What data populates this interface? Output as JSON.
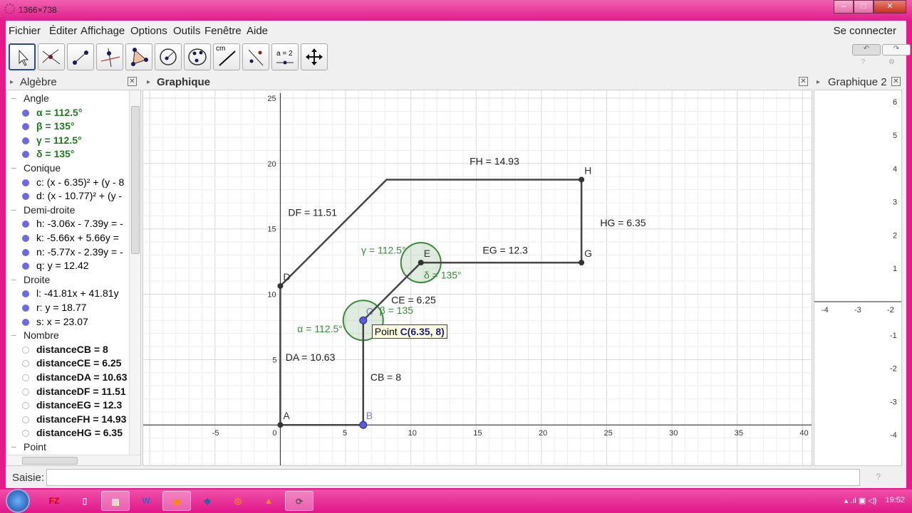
{
  "window": {
    "title": "1366×738",
    "min": "–",
    "max": "□",
    "close": "✕"
  },
  "menu": {
    "items": [
      "Fichier",
      "Éditer",
      "Affichage",
      "Options",
      "Outils",
      "Fenêtre",
      "Aide"
    ],
    "login": "Se connecter"
  },
  "toolbar": {
    "tools": [
      "move",
      "point-intersect",
      "segment",
      "perpendicular",
      "polygon",
      "circle",
      "conic-5pts",
      "distance",
      "reflect",
      "slider",
      "move-graphics"
    ],
    "measure_label": "cm",
    "slider_label": "a = 2",
    "undo": "↶",
    "redo": "↷",
    "help": "?",
    "settings": "⚙"
  },
  "panels": {
    "algebra": "Algèbre",
    "graphics": "Graphique",
    "graphics2": "Graphique 2",
    "close": "✕"
  },
  "algebra": [
    {
      "type": "cat",
      "text": "Angle"
    },
    {
      "type": "obj",
      "text": "α = 112.5°",
      "style": "green"
    },
    {
      "type": "obj",
      "text": "β = 135°",
      "style": "green"
    },
    {
      "type": "obj",
      "text": "γ = 112.5°",
      "style": "green"
    },
    {
      "type": "obj",
      "text": "δ = 135°",
      "style": "green"
    },
    {
      "type": "cat",
      "text": "Conique"
    },
    {
      "type": "obj",
      "text": "c: (x - 6.35)² + (y - 8"
    },
    {
      "type": "obj",
      "text": "d: (x - 10.77)² + (y -"
    },
    {
      "type": "cat",
      "text": "Demi-droite"
    },
    {
      "type": "obj",
      "text": "h: -3.06x - 7.39y = -"
    },
    {
      "type": "obj",
      "text": "k: -5.66x + 5.66y ="
    },
    {
      "type": "obj",
      "text": "n: -5.77x - 2.39y = -"
    },
    {
      "type": "obj",
      "text": "q: y = 12.42"
    },
    {
      "type": "cat",
      "text": "Droite"
    },
    {
      "type": "obj",
      "text": "l: -41.81x + 41.81y"
    },
    {
      "type": "obj",
      "text": "r: y = 18.77"
    },
    {
      "type": "obj",
      "text": "s: x = 23.07"
    },
    {
      "type": "cat",
      "text": "Nombre"
    },
    {
      "type": "num",
      "text": "distanceCB = 8"
    },
    {
      "type": "num",
      "text": "distanceCE = 6.25"
    },
    {
      "type": "num",
      "text": "distanceDA = 10.63"
    },
    {
      "type": "num",
      "text": "distanceDF = 11.51"
    },
    {
      "type": "num",
      "text": "distanceEG = 12.3"
    },
    {
      "type": "num",
      "text": "distanceFH = 14.93"
    },
    {
      "type": "num",
      "text": "distanceHG = 6.35"
    },
    {
      "type": "cat",
      "text": "Point"
    }
  ],
  "geometry": {
    "xrange": [
      -10.5,
      40.8
    ],
    "yrange": [
      -3.2,
      25.6
    ],
    "xticks": [
      -5,
      0,
      5,
      10,
      15,
      20,
      25,
      30,
      35,
      40
    ],
    "yticks": [
      5,
      10,
      15,
      20,
      25
    ],
    "points": {
      "A": [
        0,
        0
      ],
      "B": [
        6.35,
        0
      ],
      "C": [
        6.35,
        8
      ],
      "D": [
        0,
        10.63
      ],
      "E": [
        10.77,
        12.42
      ],
      "F": [
        8.14,
        18.77
      ],
      "G": [
        23.07,
        12.42
      ],
      "H": [
        23.07,
        18.77
      ]
    },
    "point_labels": {
      "A": "A",
      "B": "B",
      "C": "C",
      "D": "D",
      "E": "E",
      "G": "G",
      "H": "H"
    },
    "polygon": [
      "A",
      "B",
      "C",
      "E",
      "G",
      "H",
      "F",
      "D",
      "A"
    ],
    "segment_labels": [
      {
        "text": "FH = 14.93",
        "at": [
          14.5,
          19.9
        ]
      },
      {
        "text": "DF = 11.51",
        "at": [
          0.6,
          16.0
        ]
      },
      {
        "text": "HG = 6.35",
        "at": [
          24.5,
          15.2
        ]
      },
      {
        "text": "EG = 12.3",
        "at": [
          15.5,
          13.1
        ]
      },
      {
        "text": "CE = 6.25",
        "at": [
          8.5,
          9.3
        ]
      },
      {
        "text": "DA = 10.63",
        "at": [
          0.4,
          4.9
        ]
      },
      {
        "text": "CB = 8",
        "at": [
          6.9,
          3.4
        ]
      }
    ],
    "angle_labels": [
      {
        "text": "α = 112.5°",
        "at": [
          1.3,
          7.1
        ]
      },
      {
        "text": "β = 135",
        "at": [
          7.6,
          8.5
        ]
      },
      {
        "text": "γ = 112.5°",
        "at": [
          6.2,
          13.1
        ]
      },
      {
        "text": "δ = 135°",
        "at": [
          11.0,
          11.2
        ]
      }
    ],
    "tooltip": {
      "prefix": "Point ",
      "value": "C(6.35, 8)"
    },
    "angle_color": "#3a8a3a"
  },
  "graphics2": {
    "yticks": [
      "6",
      "5",
      "4",
      "3",
      "2",
      "1",
      "-1",
      "-2",
      "-3",
      "-4"
    ],
    "xticks": [
      "-4",
      "-3",
      "-2"
    ]
  },
  "input": {
    "label": "Saisie:",
    "value": "",
    "help": "?"
  },
  "taskbar": {
    "apps": [
      "FZ",
      "▯",
      "▤",
      "W",
      "◉",
      "◆",
      "◎",
      "▲",
      "⟳"
    ],
    "clock": "19:52",
    "tray": "▴ .ıl ▣ ◁)"
  }
}
